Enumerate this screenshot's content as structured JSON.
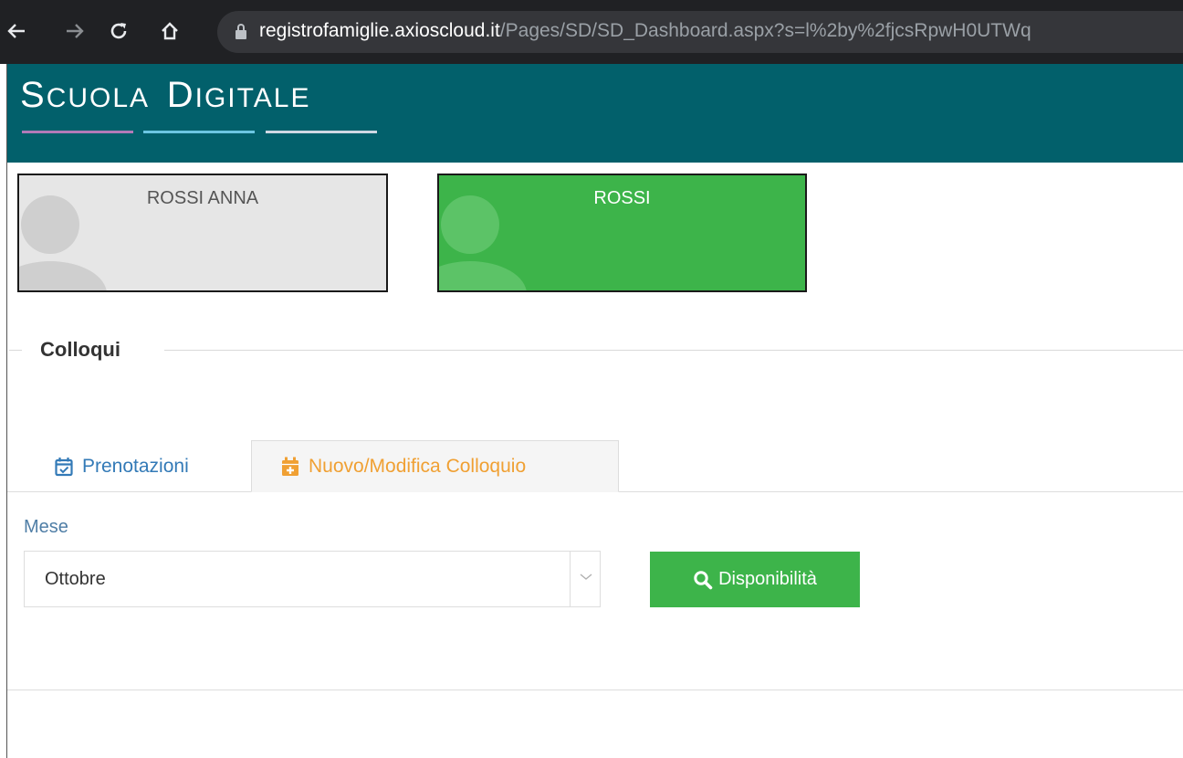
{
  "browser": {
    "url_domain": "registrofamiglie.axioscloud.it",
    "url_path": "/Pages/SD/SD_Dashboard.aspx?s=l%2by%2fjcsRpwH0UTWq"
  },
  "app": {
    "brand_first_initial": "S",
    "brand_first_rest": "CUOLA",
    "brand_second_initial": "D",
    "brand_second_rest": "IGITALE",
    "header_color": "#02606b"
  },
  "students": [
    {
      "name": "ROSSI ANNA",
      "color": "#e6e6e6",
      "selected": false
    },
    {
      "name": "ROSSI",
      "color": "#3db44a",
      "selected": true
    }
  ],
  "section": {
    "title": "Colloqui"
  },
  "tabs": [
    {
      "label": "Prenotazioni",
      "icon": "calendar-check-icon",
      "active": false
    },
    {
      "label": "Nuovo/Modifica Colloquio",
      "icon": "calendar-plus-icon",
      "active": true
    }
  ],
  "form": {
    "month_label": "Mese",
    "month_value": "Ottobre",
    "availability_button": "Disponibilità"
  },
  "colors": {
    "accent_green": "#3db44a",
    "tab_active_text": "#f0a033",
    "tab_link": "#337ab7"
  }
}
